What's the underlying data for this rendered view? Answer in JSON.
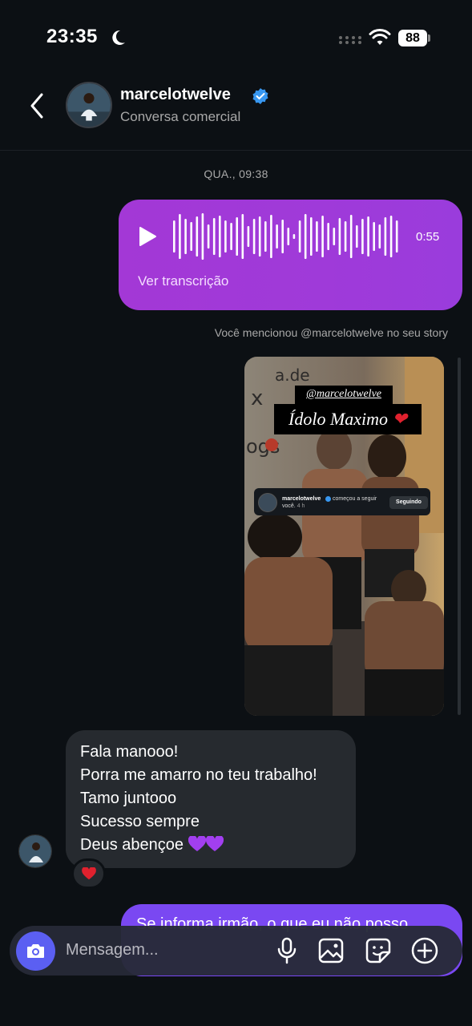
{
  "status_bar": {
    "time": "23:35",
    "battery": "88",
    "icons": [
      "moon-icon",
      "signal-dots-icon",
      "wifi-icon",
      "battery-icon"
    ]
  },
  "header": {
    "back_icon": "chevron-left-icon",
    "username": "marcelotwelve",
    "verified_icon": "verified-badge-icon",
    "subtitle": "Conversa comercial"
  },
  "thread": {
    "day_stamp": "QUA., 09:38",
    "voice_message": {
      "duration": "0:55",
      "transcript_label": "Ver transcrição",
      "color": "#a338d6"
    },
    "mention_note": "Você mencionou @marcelotwelve no seu story",
    "story": {
      "tag": "@marcelotwelve",
      "title": "Ídolo Maximo",
      "follow_card": {
        "name": "marcelotwelve",
        "action": "começou a seguir",
        "line2_prefix": "você.",
        "time": "4 h",
        "button": "Seguindo"
      }
    },
    "received_message": {
      "lines": [
        "Fala manooo!",
        "Porra me amarro no teu trabalho!",
        "Tamo juntooo",
        "Sucesso sempre",
        "Deus abençoe"
      ],
      "reaction": "❤️"
    },
    "outgoing_partial": {
      "text": "Se informa irmão, o que eu não posso",
      "color": "#7a48f2"
    }
  },
  "composer": {
    "placeholder": "Mensagem...",
    "accent": "#5b5ff2"
  }
}
